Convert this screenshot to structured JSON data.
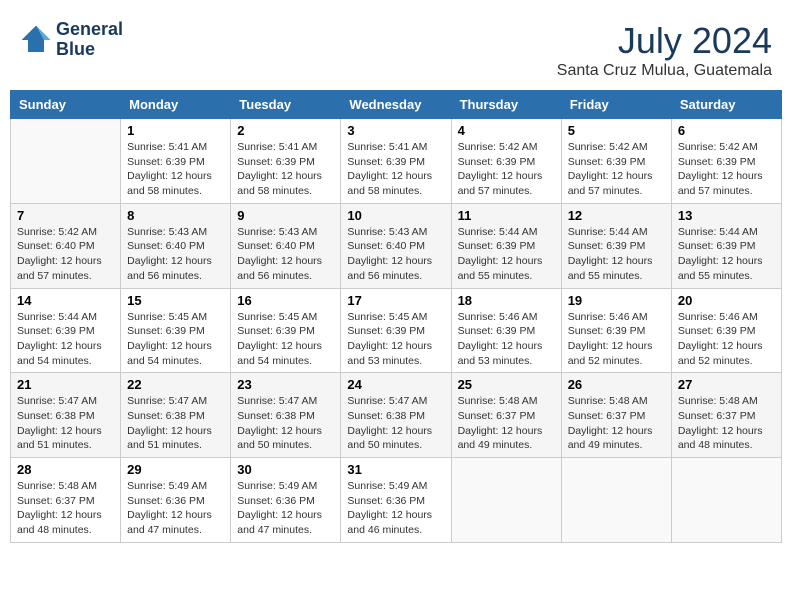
{
  "header": {
    "logo_line1": "General",
    "logo_line2": "Blue",
    "month": "July 2024",
    "location": "Santa Cruz Mulua, Guatemala"
  },
  "weekdays": [
    "Sunday",
    "Monday",
    "Tuesday",
    "Wednesday",
    "Thursday",
    "Friday",
    "Saturday"
  ],
  "weeks": [
    [
      {
        "day": "",
        "sunrise": "",
        "sunset": "",
        "daylight": ""
      },
      {
        "day": "1",
        "sunrise": "Sunrise: 5:41 AM",
        "sunset": "Sunset: 6:39 PM",
        "daylight": "Daylight: 12 hours and 58 minutes."
      },
      {
        "day": "2",
        "sunrise": "Sunrise: 5:41 AM",
        "sunset": "Sunset: 6:39 PM",
        "daylight": "Daylight: 12 hours and 58 minutes."
      },
      {
        "day": "3",
        "sunrise": "Sunrise: 5:41 AM",
        "sunset": "Sunset: 6:39 PM",
        "daylight": "Daylight: 12 hours and 58 minutes."
      },
      {
        "day": "4",
        "sunrise": "Sunrise: 5:42 AM",
        "sunset": "Sunset: 6:39 PM",
        "daylight": "Daylight: 12 hours and 57 minutes."
      },
      {
        "day": "5",
        "sunrise": "Sunrise: 5:42 AM",
        "sunset": "Sunset: 6:39 PM",
        "daylight": "Daylight: 12 hours and 57 minutes."
      },
      {
        "day": "6",
        "sunrise": "Sunrise: 5:42 AM",
        "sunset": "Sunset: 6:39 PM",
        "daylight": "Daylight: 12 hours and 57 minutes."
      }
    ],
    [
      {
        "day": "7",
        "sunrise": "Sunrise: 5:42 AM",
        "sunset": "Sunset: 6:40 PM",
        "daylight": "Daylight: 12 hours and 57 minutes."
      },
      {
        "day": "8",
        "sunrise": "Sunrise: 5:43 AM",
        "sunset": "Sunset: 6:40 PM",
        "daylight": "Daylight: 12 hours and 56 minutes."
      },
      {
        "day": "9",
        "sunrise": "Sunrise: 5:43 AM",
        "sunset": "Sunset: 6:40 PM",
        "daylight": "Daylight: 12 hours and 56 minutes."
      },
      {
        "day": "10",
        "sunrise": "Sunrise: 5:43 AM",
        "sunset": "Sunset: 6:40 PM",
        "daylight": "Daylight: 12 hours and 56 minutes."
      },
      {
        "day": "11",
        "sunrise": "Sunrise: 5:44 AM",
        "sunset": "Sunset: 6:39 PM",
        "daylight": "Daylight: 12 hours and 55 minutes."
      },
      {
        "day": "12",
        "sunrise": "Sunrise: 5:44 AM",
        "sunset": "Sunset: 6:39 PM",
        "daylight": "Daylight: 12 hours and 55 minutes."
      },
      {
        "day": "13",
        "sunrise": "Sunrise: 5:44 AM",
        "sunset": "Sunset: 6:39 PM",
        "daylight": "Daylight: 12 hours and 55 minutes."
      }
    ],
    [
      {
        "day": "14",
        "sunrise": "Sunrise: 5:44 AM",
        "sunset": "Sunset: 6:39 PM",
        "daylight": "Daylight: 12 hours and 54 minutes."
      },
      {
        "day": "15",
        "sunrise": "Sunrise: 5:45 AM",
        "sunset": "Sunset: 6:39 PM",
        "daylight": "Daylight: 12 hours and 54 minutes."
      },
      {
        "day": "16",
        "sunrise": "Sunrise: 5:45 AM",
        "sunset": "Sunset: 6:39 PM",
        "daylight": "Daylight: 12 hours and 54 minutes."
      },
      {
        "day": "17",
        "sunrise": "Sunrise: 5:45 AM",
        "sunset": "Sunset: 6:39 PM",
        "daylight": "Daylight: 12 hours and 53 minutes."
      },
      {
        "day": "18",
        "sunrise": "Sunrise: 5:46 AM",
        "sunset": "Sunset: 6:39 PM",
        "daylight": "Daylight: 12 hours and 53 minutes."
      },
      {
        "day": "19",
        "sunrise": "Sunrise: 5:46 AM",
        "sunset": "Sunset: 6:39 PM",
        "daylight": "Daylight: 12 hours and 52 minutes."
      },
      {
        "day": "20",
        "sunrise": "Sunrise: 5:46 AM",
        "sunset": "Sunset: 6:39 PM",
        "daylight": "Daylight: 12 hours and 52 minutes."
      }
    ],
    [
      {
        "day": "21",
        "sunrise": "Sunrise: 5:47 AM",
        "sunset": "Sunset: 6:38 PM",
        "daylight": "Daylight: 12 hours and 51 minutes."
      },
      {
        "day": "22",
        "sunrise": "Sunrise: 5:47 AM",
        "sunset": "Sunset: 6:38 PM",
        "daylight": "Daylight: 12 hours and 51 minutes."
      },
      {
        "day": "23",
        "sunrise": "Sunrise: 5:47 AM",
        "sunset": "Sunset: 6:38 PM",
        "daylight": "Daylight: 12 hours and 50 minutes."
      },
      {
        "day": "24",
        "sunrise": "Sunrise: 5:47 AM",
        "sunset": "Sunset: 6:38 PM",
        "daylight": "Daylight: 12 hours and 50 minutes."
      },
      {
        "day": "25",
        "sunrise": "Sunrise: 5:48 AM",
        "sunset": "Sunset: 6:37 PM",
        "daylight": "Daylight: 12 hours and 49 minutes."
      },
      {
        "day": "26",
        "sunrise": "Sunrise: 5:48 AM",
        "sunset": "Sunset: 6:37 PM",
        "daylight": "Daylight: 12 hours and 49 minutes."
      },
      {
        "day": "27",
        "sunrise": "Sunrise: 5:48 AM",
        "sunset": "Sunset: 6:37 PM",
        "daylight": "Daylight: 12 hours and 48 minutes."
      }
    ],
    [
      {
        "day": "28",
        "sunrise": "Sunrise: 5:48 AM",
        "sunset": "Sunset: 6:37 PM",
        "daylight": "Daylight: 12 hours and 48 minutes."
      },
      {
        "day": "29",
        "sunrise": "Sunrise: 5:49 AM",
        "sunset": "Sunset: 6:36 PM",
        "daylight": "Daylight: 12 hours and 47 minutes."
      },
      {
        "day": "30",
        "sunrise": "Sunrise: 5:49 AM",
        "sunset": "Sunset: 6:36 PM",
        "daylight": "Daylight: 12 hours and 47 minutes."
      },
      {
        "day": "31",
        "sunrise": "Sunrise: 5:49 AM",
        "sunset": "Sunset: 6:36 PM",
        "daylight": "Daylight: 12 hours and 46 minutes."
      },
      {
        "day": "",
        "sunrise": "",
        "sunset": "",
        "daylight": ""
      },
      {
        "day": "",
        "sunrise": "",
        "sunset": "",
        "daylight": ""
      },
      {
        "day": "",
        "sunrise": "",
        "sunset": "",
        "daylight": ""
      }
    ]
  ]
}
